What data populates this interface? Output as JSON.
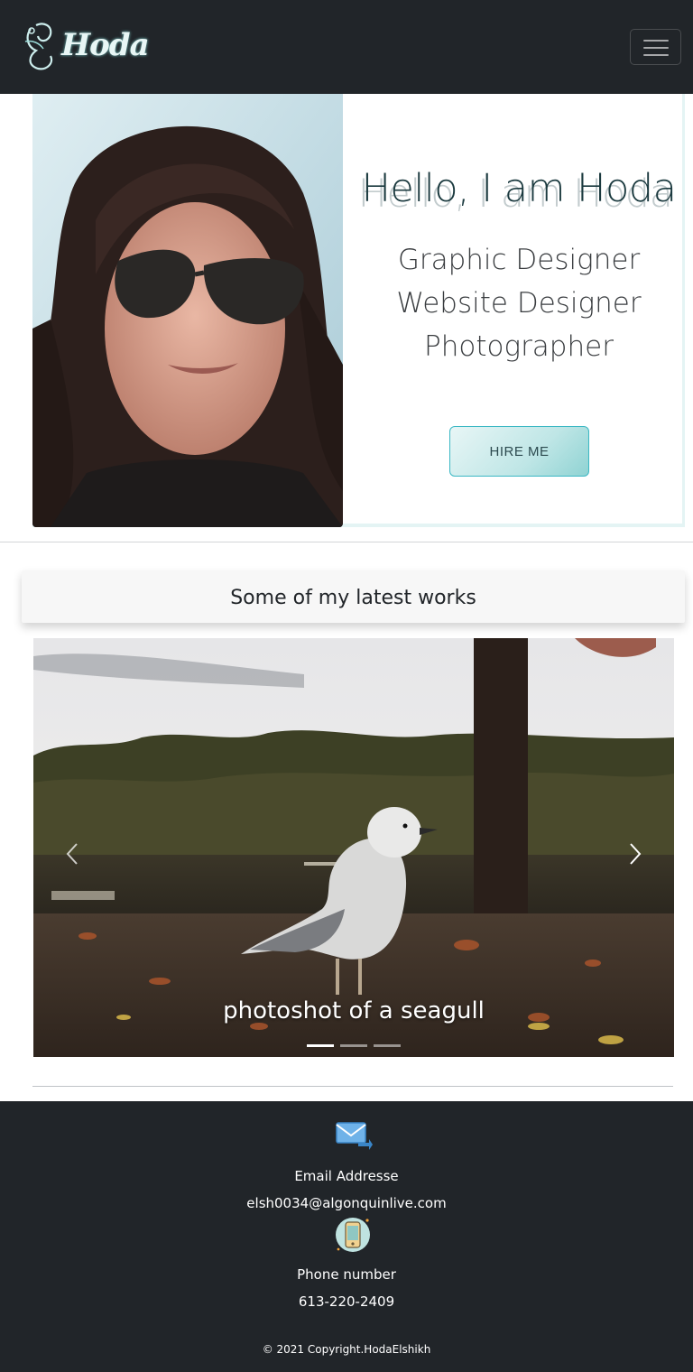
{
  "navbar": {
    "logo_text": "Hoda",
    "toggler_icon": "hamburger-icon"
  },
  "hero": {
    "title": "Hello, I am Hoda",
    "roles": [
      "Graphic Designer",
      "Website Designer",
      "Photographer"
    ],
    "hire_button": "HIRE ME",
    "accent_color": "#3bb8c4"
  },
  "works": {
    "heading": "Some of my latest works",
    "carousel": {
      "caption": "photoshot of a seagull",
      "slide_count": 3,
      "active_index": 0,
      "prev_icon": "chevron-left-icon",
      "next_icon": "chevron-right-icon"
    }
  },
  "footer": {
    "email_icon": "envelope-icon",
    "email_label": "Email Addresse",
    "email_value": "elsh0034@algonquinlive.com",
    "phone_icon": "phone-icon",
    "phone_label": "Phone number",
    "phone_value": "613-220-2409",
    "copyright": "© 2021 Copyright.HodaElshikh"
  },
  "colors": {
    "dark": "#212529",
    "hero_bg": "#e4f4f4"
  }
}
